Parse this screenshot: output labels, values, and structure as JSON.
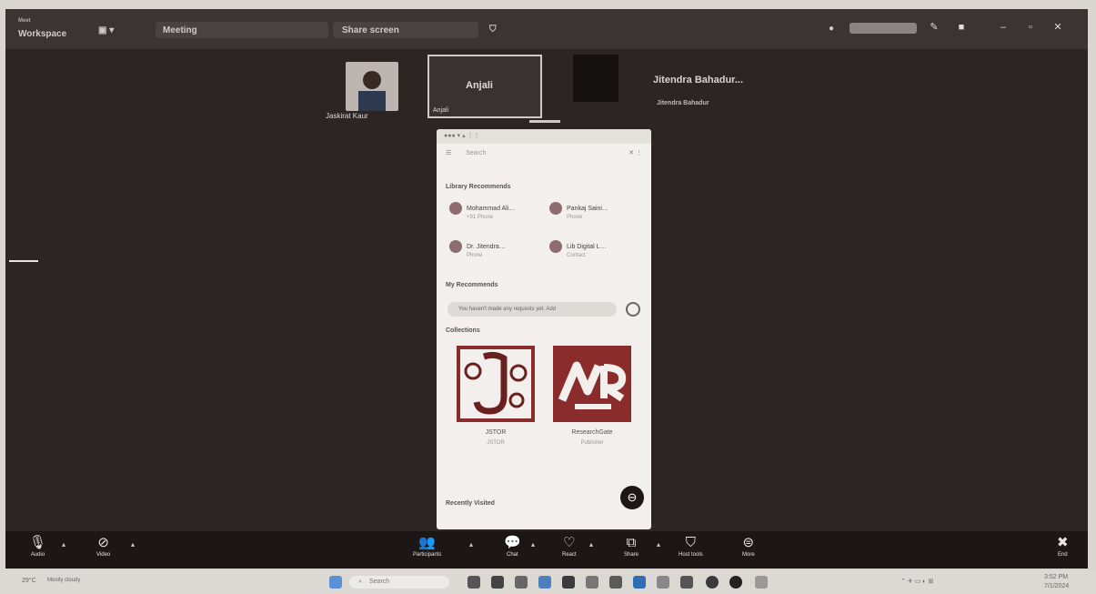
{
  "window": {
    "app_title": "Meet",
    "workspace_label": "Workspace",
    "tab_meeting": "Meeting",
    "tab_share": "Share screen",
    "search_value": ""
  },
  "participants": [
    {
      "name": "Jaskirat Kaur",
      "initials": ""
    },
    {
      "name": "Anjali",
      "initials": "Anjali"
    },
    {
      "name": "",
      "initials": ""
    },
    {
      "name": "Jitendra Bahadur",
      "initials": "Jitendra Bahadur..."
    }
  ],
  "phone": {
    "search_placeholder": "Search",
    "section_library": "Library Recommends",
    "contacts": [
      {
        "name": "Mohammad Ali…",
        "sub": "+91 Phone"
      },
      {
        "name": "Pankaj Saini…",
        "sub": "Phone"
      },
      {
        "name": "Dr. Jitendra…",
        "sub": "Phone"
      },
      {
        "name": "Lib Digital L…",
        "sub": "Contact"
      }
    ],
    "section_recommend": "My Recommends",
    "recommend_text": "You haven't made any requests yet. Add",
    "section_collections": "Collections",
    "collection1_title": "JSTOR",
    "collection1_sub": "JSTOR",
    "collection2_title": "ResearchGate",
    "collection2_sub": "Publisher",
    "section_recent": "Recently Visited"
  },
  "controls": {
    "audio": "Audio",
    "video": "Video",
    "participants": "Participants",
    "chat": "Chat",
    "react": "React",
    "share": "Share",
    "host_tools": "Host tools",
    "more": "More",
    "end": "End"
  },
  "taskbar": {
    "search": "Search",
    "weather": "29°C",
    "weather_sub": "Mostly cloudy",
    "time": "3:52 PM",
    "date": "7/1/2024"
  },
  "colors": {
    "bg": "#2c2523",
    "accent": "#8a2c2c"
  }
}
